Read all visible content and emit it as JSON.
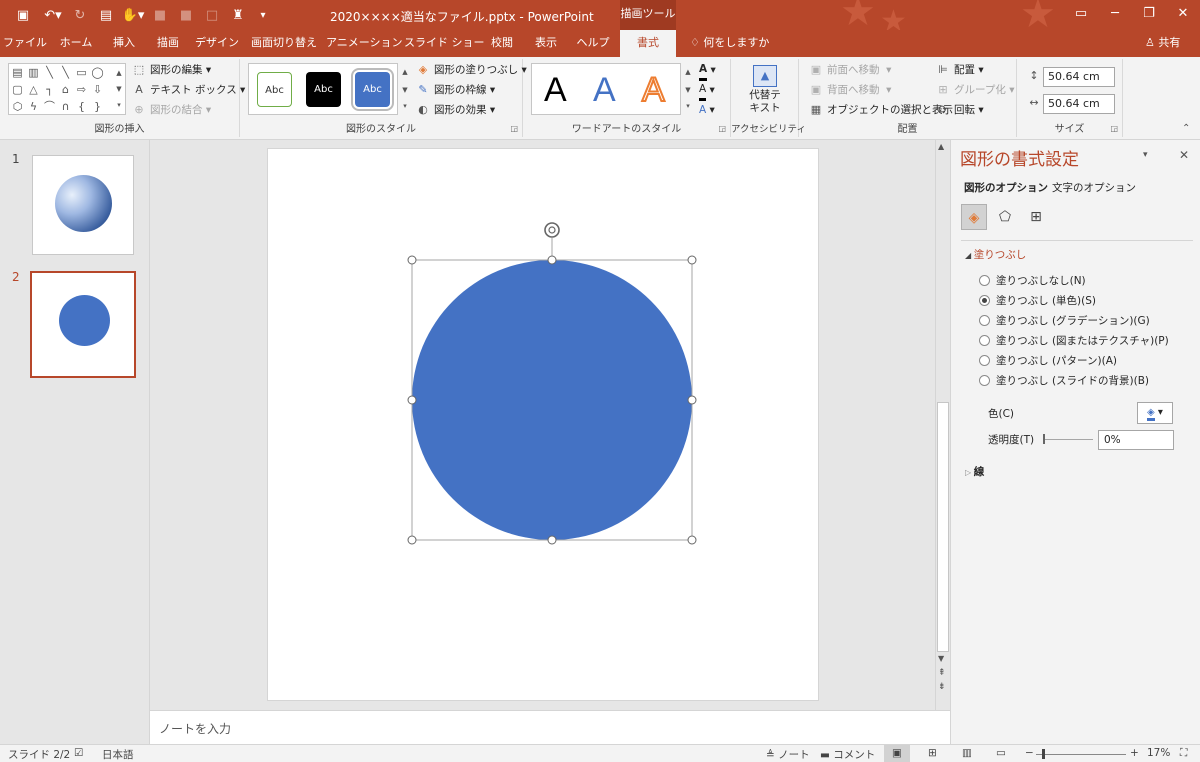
{
  "window": {
    "title": "2020××××適当なファイル.pptx  -  PowerPoint",
    "context_tab": "描画ツール",
    "accent": "#b7472a"
  },
  "ribbon_tabs": [
    "ファイル",
    "ホーム",
    "挿入",
    "描画",
    "デザイン",
    "画面切り替え",
    "アニメーション",
    "スライド ショー",
    "校閲",
    "表示",
    "ヘルプ",
    "書式"
  ],
  "active_tab": "書式",
  "tell_me": "何をしますか",
  "share": "共有",
  "groups": {
    "insert_shapes": {
      "label": "図形の挿入",
      "edit_shape": "図形の編集",
      "text_box": "テキスト ボックス",
      "merge_shapes": "図形の結合"
    },
    "shape_styles": {
      "label": "図形のスタイル",
      "samples": [
        "Abc",
        "Abc",
        "Abc"
      ],
      "fill": "図形の塗りつぶし",
      "outline": "図形の枠線",
      "effects": "図形の効果"
    },
    "wordart": {
      "label": "ワードアートのスタイル",
      "samples": [
        "A",
        "A",
        "A"
      ],
      "text_fill_icon": "A",
      "text_outline_icon": "A",
      "text_effects_icon": "A"
    },
    "accessibility": {
      "label": "アクセシビリティ",
      "alt_text_line1": "代替テ",
      "alt_text_line2": "キスト"
    },
    "arrange": {
      "label": "配置",
      "bring_forward": "前面へ移動",
      "send_backward": "背面へ移動",
      "selection_pane": "オブジェクトの選択と表示",
      "align": "配置",
      "group": "グループ化",
      "rotate": "回転"
    },
    "size": {
      "label": "サイズ",
      "height": "50.64 cm",
      "width": "50.64 cm"
    }
  },
  "slides": [
    {
      "number": "1"
    },
    {
      "number": "2"
    }
  ],
  "shape": {
    "fill": "#4472c4"
  },
  "notes_placeholder": "ノートを入力",
  "format_pane": {
    "title": "図形の書式設定",
    "tab_shape": "図形のオプション",
    "tab_text": "文字のオプション",
    "fill_section": "塗りつぶし",
    "options": [
      "塗りつぶしなし(N)",
      "塗りつぶし (単色)(S)",
      "塗りつぶし (グラデーション)(G)",
      "塗りつぶし (図またはテクスチャ)(P)",
      "塗りつぶし (パターン)(A)",
      "塗りつぶし (スライドの背景)(B)"
    ],
    "selected_index": 1,
    "color_label": "色(C)",
    "transparency_label": "透明度(T)",
    "transparency_value": "0%",
    "line_section": "線"
  },
  "status": {
    "slide": "スライド 2/2",
    "language": "日本語",
    "notes": "ノート",
    "comments": "コメント",
    "zoom": "17%"
  }
}
